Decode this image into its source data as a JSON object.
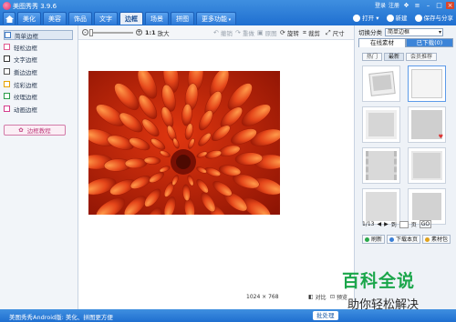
{
  "window": {
    "title": "美图秀秀 3.9.6",
    "user_links": [
      "登录",
      "注册"
    ]
  },
  "tabs": [
    {
      "label": "美化",
      "active": false
    },
    {
      "label": "美容",
      "active": false
    },
    {
      "label": "饰品",
      "active": false
    },
    {
      "label": "文字",
      "active": false
    },
    {
      "label": "边框",
      "active": true
    },
    {
      "label": "场景",
      "active": false
    },
    {
      "label": "拼图",
      "active": false
    },
    {
      "label": "更多功能",
      "active": false
    }
  ],
  "top_actions": {
    "open": "打开",
    "new": "新建",
    "save_share": "保存与分享"
  },
  "left_panel": {
    "items": [
      {
        "label": "简单边框",
        "color": "#3b78c4",
        "active": true
      },
      {
        "label": "轻松边框",
        "color": "#e05a8f",
        "active": false
      },
      {
        "label": "文字边框",
        "color": "#333333",
        "active": false
      },
      {
        "label": "撕边边框",
        "color": "#555555",
        "active": false
      },
      {
        "label": "炫彩边框",
        "color": "#e8a300",
        "active": false
      },
      {
        "label": "纹理边框",
        "color": "#2c9c4a",
        "active": false
      },
      {
        "label": "动画边框",
        "color": "#d43c8c",
        "active": false
      }
    ],
    "tutorial": "边框教程"
  },
  "toolbar": {
    "zoom_value": "1:1",
    "enlarge": "放大",
    "undo": "撤销",
    "redo": "重做",
    "original": "原图",
    "rotate": "旋转",
    "crop": "裁剪",
    "resize": "尺寸"
  },
  "status": {
    "image_size": "1024 × 768",
    "compare": "对比",
    "preview": "预览"
  },
  "right_panel": {
    "category_label": "切换分类",
    "category_value": "简单边框",
    "tabs": [
      {
        "label": "在线素材",
        "active": true
      },
      {
        "label": "已下载(0)",
        "active": false
      }
    ],
    "subtabs": [
      {
        "label": "热门",
        "active": false
      },
      {
        "label": "最新",
        "active": true
      },
      {
        "label": "会员推荐",
        "active": false
      }
    ],
    "pager": {
      "current": "1/13",
      "jump_label": "到",
      "page_label": "页"
    },
    "actions": [
      "刷新",
      "下载本页",
      "素材包"
    ]
  },
  "bottom_bar": {
    "promo": "美图秀秀Android版: 美化、拼图更方便",
    "batch": "批处理"
  },
  "watermark": {
    "line1": "百科全说",
    "line2": "助你轻松解决"
  }
}
